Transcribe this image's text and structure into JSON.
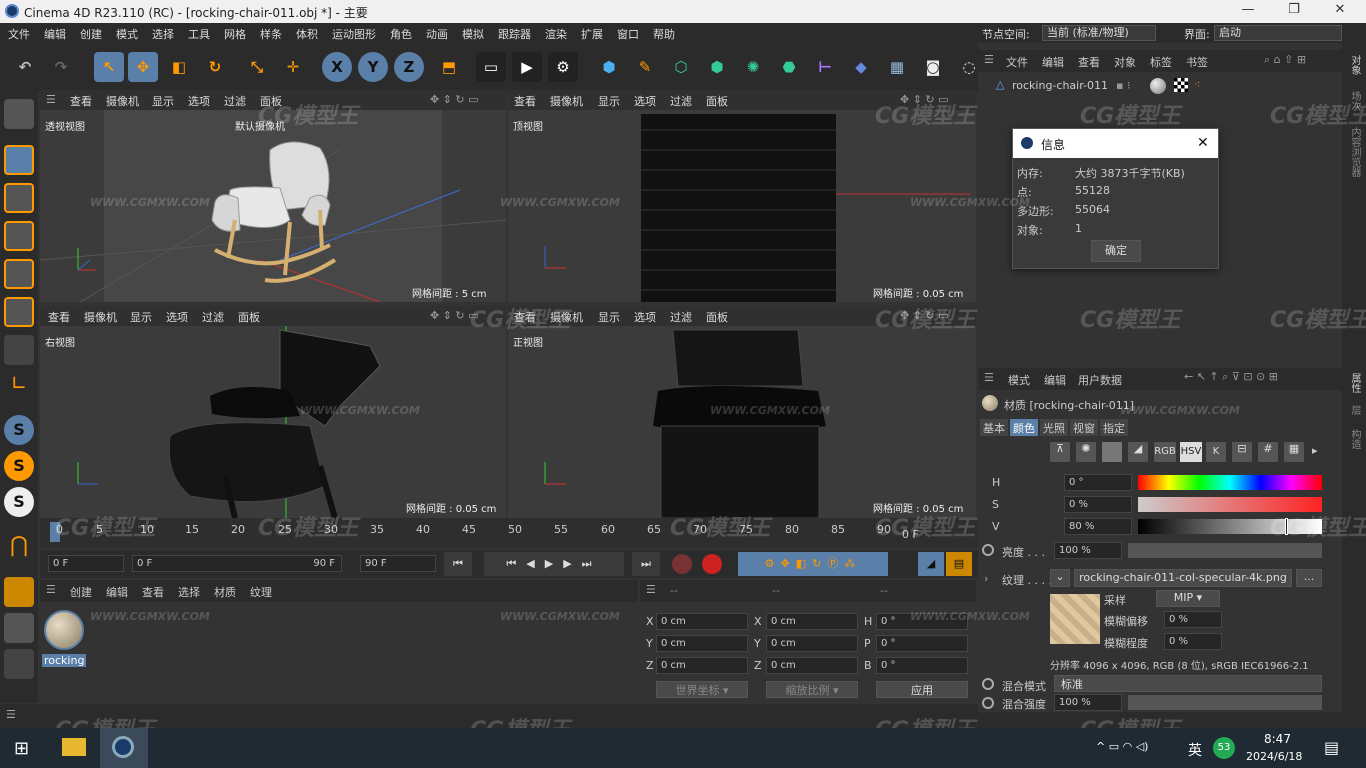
{
  "window": {
    "title": "Cinema 4D R23.110 (RC) - [rocking-chair-011.obj *] - 主要",
    "minimize": "—",
    "maximize": "❐",
    "close": "✕"
  },
  "menu": [
    "文件",
    "编辑",
    "创建",
    "模式",
    "选择",
    "工具",
    "网格",
    "样条",
    "体积",
    "运动图形",
    "角色",
    "动画",
    "模拟",
    "跟踪器",
    "渲染",
    "扩展",
    "窗口",
    "帮助"
  ],
  "node_space": {
    "label": "节点空间:",
    "value": "当前 (标准/物理)"
  },
  "interface": {
    "label": "界面:",
    "value": "启动"
  },
  "viewport_menu": [
    "查看",
    "摄像机",
    "显示",
    "选项",
    "过滤",
    "面板"
  ],
  "viewports": [
    {
      "name": "透视视图",
      "camera": "默认摄像机",
      "grid": "网格间距 : 5 cm"
    },
    {
      "name": "顶视图",
      "grid": "网格间距 : 0.05 cm"
    },
    {
      "name": "右视图",
      "grid": "网格间距 : 0.05 cm"
    },
    {
      "name": "正视图",
      "grid": "网格间距 : 0.05 cm"
    }
  ],
  "timeline": {
    "ticks": [
      "0",
      "5",
      "10",
      "15",
      "20",
      "25",
      "30",
      "35",
      "40",
      "45",
      "50",
      "55",
      "60",
      "65",
      "70",
      "75",
      "80",
      "85",
      "90"
    ],
    "current": "0 F",
    "start": "0 F",
    "range_start": "0 F",
    "range_end": "90 F",
    "end": "90 F"
  },
  "material_manager": {
    "menu": [
      "创建",
      "编辑",
      "查看",
      "选择",
      "材质",
      "纹理"
    ],
    "material_name": "rocking"
  },
  "coords": {
    "header": [
      "--",
      "--",
      "--"
    ],
    "rows": [
      {
        "a": "X",
        "av": "0 cm",
        "b": "X",
        "bv": "0 cm",
        "c": "H",
        "cv": "0 °"
      },
      {
        "a": "Y",
        "av": "0 cm",
        "b": "Y",
        "bv": "0 cm",
        "c": "P",
        "cv": "0 °"
      },
      {
        "a": "Z",
        "av": "0 cm",
        "b": "Z",
        "bv": "0 cm",
        "c": "B",
        "cv": "0 °"
      }
    ],
    "world": "世界坐标",
    "scale": "缩放比例",
    "apply": "应用"
  },
  "object_manager": {
    "menu": [
      "文件",
      "编辑",
      "查看",
      "对象",
      "标签",
      "书签"
    ],
    "object": "rocking-chair-011"
  },
  "info_dialog": {
    "title": "信息",
    "rows": [
      {
        "k": "内存:",
        "v": "大约 3873千字节(KB)"
      },
      {
        "k": "点:",
        "v": "55128"
      },
      {
        "k": "多边形:",
        "v": "55064"
      },
      {
        "k": "对象:",
        "v": "1"
      }
    ],
    "ok": "确定",
    "close": "✕"
  },
  "attributes": {
    "menu": [
      "模式",
      "编辑",
      "用户数据"
    ],
    "title": "材质 [rocking-chair-011]",
    "tabs": [
      "基本",
      "颜色",
      "光照",
      "视窗",
      "指定"
    ],
    "active_tab": "颜色",
    "color_modes": [
      "RGB",
      "HSV",
      "K",
      "#"
    ],
    "h": {
      "label": "H",
      "value": "0 °"
    },
    "s": {
      "label": "S",
      "value": "0 %"
    },
    "v": {
      "label": "V",
      "value": "80 %",
      "level": 0.8
    },
    "brightness": {
      "label": "亮度 . . .",
      "value": "100 %"
    },
    "texture": {
      "label": "纹理 . . . . .",
      "file": "rocking-chair-011-col-specular-4k.png",
      "more": "..."
    },
    "sampling": {
      "label": "采样",
      "value": "MIP"
    },
    "blur_offset": {
      "label": "模糊偏移",
      "value": "0 %"
    },
    "blur_scale": {
      "label": "模糊程度",
      "value": "0 %"
    },
    "resolution": "分辨率 4096 x 4096, RGB (8 位), sRGB IEC61966-2.1",
    "blend_mode": {
      "label": "混合模式",
      "value": "标准"
    },
    "blend_strength": {
      "label": "混合强度",
      "value": "100 %"
    }
  },
  "side_tabs_top": [
    "对象",
    "场次",
    "内容浏览器"
  ],
  "side_tabs_bottom": [
    "属性",
    "层",
    "构造"
  ],
  "watermark": {
    "text": "CG模型王",
    "url": "WWW.CGMXW.COM"
  },
  "taskbar": {
    "time": "8:47",
    "date": "2024/6/18",
    "ime": "英",
    "badge": "53"
  }
}
